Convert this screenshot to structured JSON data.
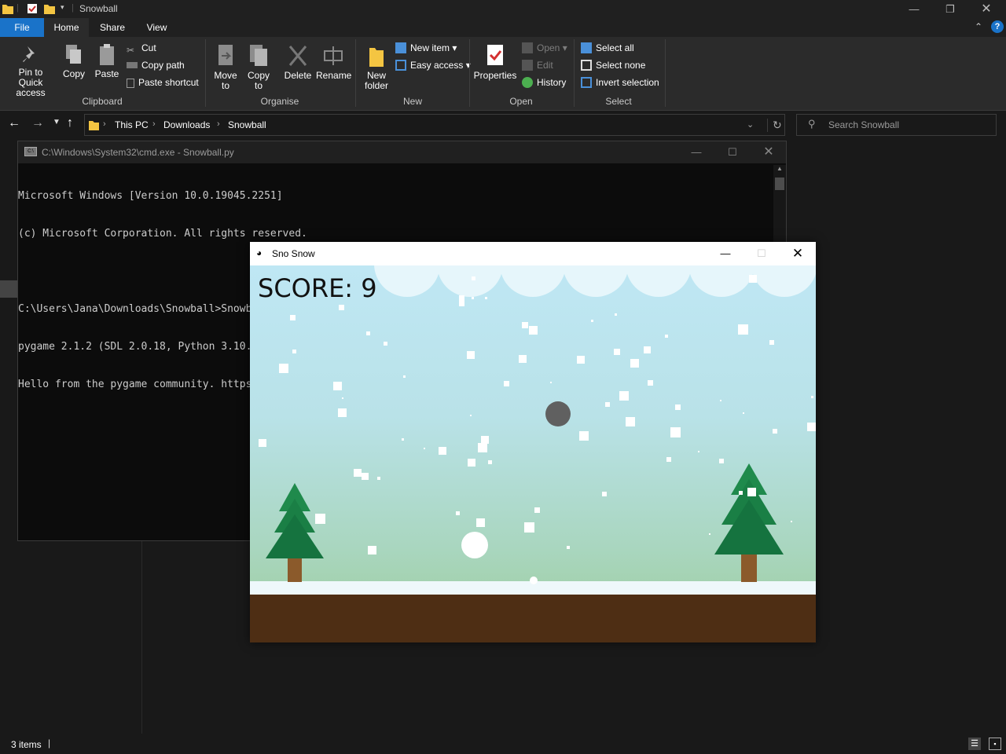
{
  "explorer": {
    "title": "Snowball",
    "tabs": [
      "File",
      "Home",
      "Share",
      "View"
    ],
    "ribbon": {
      "clipboard": {
        "pin": "Pin to Quick access",
        "copy": "Copy",
        "paste": "Paste",
        "cut": "Cut",
        "copy_path": "Copy path",
        "paste_shortcut": "Paste shortcut",
        "label": "Clipboard"
      },
      "organise": {
        "move_to": "Move to",
        "copy_to": "Copy to",
        "delete": "Delete",
        "rename": "Rename",
        "label": "Organise"
      },
      "new": {
        "new_folder": "New folder",
        "new_item": "New item",
        "easy_access": "Easy access",
        "label": "New"
      },
      "open": {
        "properties": "Properties",
        "open": "Open",
        "edit": "Edit",
        "history": "History",
        "label": "Open"
      },
      "select": {
        "select_all": "Select all",
        "select_none": "Select none",
        "invert_selection": "Invert selection",
        "label": "Select"
      }
    },
    "breadcrumb": [
      "This PC",
      "Downloads",
      "Snowball"
    ],
    "search_placeholder": "Search Snowball",
    "status": "3 items"
  },
  "cmd": {
    "title": "C:\\Windows\\System32\\cmd.exe - Snowball.py",
    "lines": [
      "Microsoft Windows [Version 10.0.19045.2251]",
      "(c) Microsoft Corporation. All rights reserved.",
      "",
      "C:\\Users\\Jana\\Downloads\\Snowball>Snowball.py",
      "pygame 2.1.2 (SDL 2.0.18, Python 3.10.0)",
      "Hello from the pygame community. https://www.pygame.org/contribute.html"
    ]
  },
  "game": {
    "title": "Sno Snow",
    "score_text": "SCORE: 9"
  },
  "colors": {
    "accent": "#0078d7",
    "tree": "#1f8a4c",
    "ground": "#5a3417"
  }
}
